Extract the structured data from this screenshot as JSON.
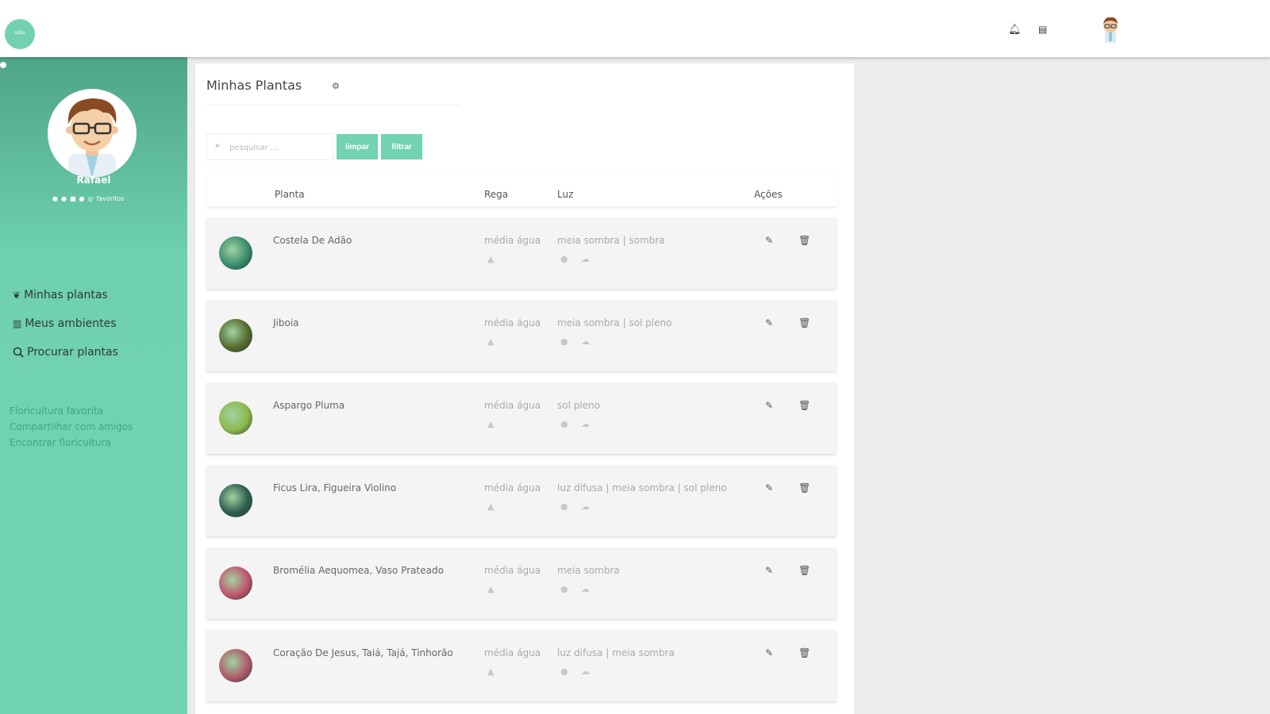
{
  "colors": {
    "brand": "#71d3b1",
    "sidebar_top": "#4ea585",
    "background": "#ececec"
  },
  "topbar": {
    "logo_label": "vida",
    "icons": [
      "bell-icon",
      "message-icon",
      "user-avatar"
    ]
  },
  "sidebar": {
    "profile_name": "Rafael",
    "social_label": "favoritos",
    "nav": [
      {
        "icon": "leaf-icon",
        "label": "Minhas plantas"
      },
      {
        "icon": "home-icon",
        "label": "Meus ambientes"
      },
      {
        "icon": "search-icon",
        "label": "Procurar plantas"
      }
    ],
    "links": [
      "Floricultura favorita",
      "Compartilhar com amigos",
      "Encontrar floricultura"
    ]
  },
  "main": {
    "title": "Minhas Plantas",
    "search_placeholder": "pesquisar ...",
    "clear_button": "limpar",
    "filter_button": "filtrar",
    "columns": {
      "plant": "Planta",
      "water": "Rega",
      "light": "Luz",
      "actions": "Ações"
    },
    "rows": [
      {
        "name": "Costela De Adão",
        "water": "média água",
        "light": "meia sombra | sombra",
        "thumb": "#3b8c6e"
      },
      {
        "name": "Jiboia",
        "water": "média água",
        "light": "meia sombra | sol pleno",
        "thumb": "#556b2f"
      },
      {
        "name": "Aspargo Pluma",
        "water": "média água",
        "light": "sol pleno",
        "thumb": "#8fb84e"
      },
      {
        "name": "Ficus Lira, Figueira Violino",
        "water": "média água",
        "light": "luz difusa | meia sombra | sol pleno",
        "thumb": "#2e5e4e"
      },
      {
        "name": "Bromélia Aequomea, Vaso Prateado",
        "water": "média água",
        "light": "meia sombra",
        "thumb": "#c0566e"
      },
      {
        "name": "Coração De Jesus, Taiá, Tajá, Tinhorão",
        "water": "média água",
        "light": "luz difusa | meia sombra",
        "thumb": "#b05a6a"
      }
    ]
  }
}
